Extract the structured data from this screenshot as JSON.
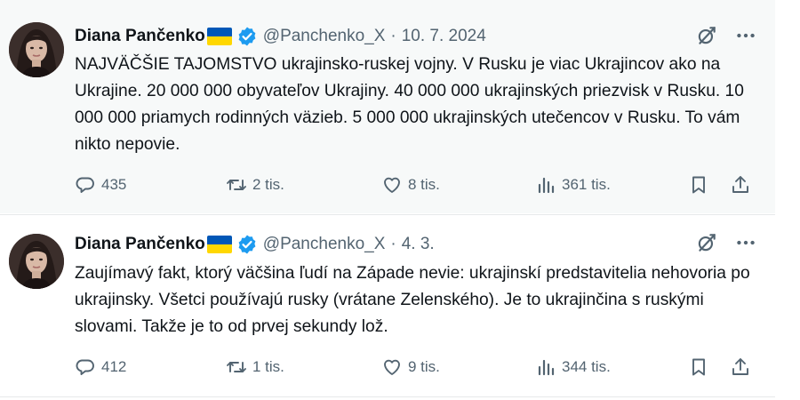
{
  "tweets": [
    {
      "author": {
        "name": "Diana Pančenko",
        "flag": "ukraine-flag",
        "verified": "verified-badge",
        "handle": "@Panchenko_X"
      },
      "separator": "·",
      "date": "10. 7. 2024",
      "text": "NAJVÄČŠIE TAJOMSTVO ukrajinsko-ruskej vojny. V Rusku je viac Ukrajincov ako na Ukrajine. 20 000 000 obyvateľov Ukrajiny. 40 000 000 ukrajinských priezvisk v Rusku. 10 000 000 priamych rodinných väzieb. 5 000 000 ukrajinských utečencov v Rusku. To vám nikto nepovie.",
      "stats": {
        "replies": "435",
        "reposts": "2 tis.",
        "likes": "8 tis.",
        "views": "361 tis."
      }
    },
    {
      "author": {
        "name": "Diana Pančenko",
        "flag": "ukraine-flag",
        "verified": "verified-badge",
        "handle": "@Panchenko_X"
      },
      "separator": "·",
      "date": "4. 3.",
      "text": "Zaujímavý fakt, ktorý väčšina ľudí na Západe nevie: ukrajinskí predstavitelia nehovoria po ukrajinsky. Všetci používajú rusky (vrátane Zelenského). Je to ukrajinčina s ruskými slovami. Takže je to od prvej sekundy lož.",
      "stats": {
        "replies": "412",
        "reposts": "1 tis.",
        "likes": "9 tis.",
        "views": "344 tis."
      }
    }
  ],
  "icons": {
    "grok": "grok-icon",
    "more": "more-icon",
    "reply": "reply-icon",
    "repost": "repost-icon",
    "like": "heart-icon",
    "views": "views-icon",
    "bookmark": "bookmark-icon",
    "share": "share-icon"
  },
  "colors": {
    "text": "#0f1419",
    "secondary": "#536471",
    "verified": "#1d9bf0",
    "highlight_background": "#f7f9f9",
    "divider": "#e7e9ea",
    "flag_blue": "#0057b7",
    "flag_yellow": "#ffd700"
  }
}
